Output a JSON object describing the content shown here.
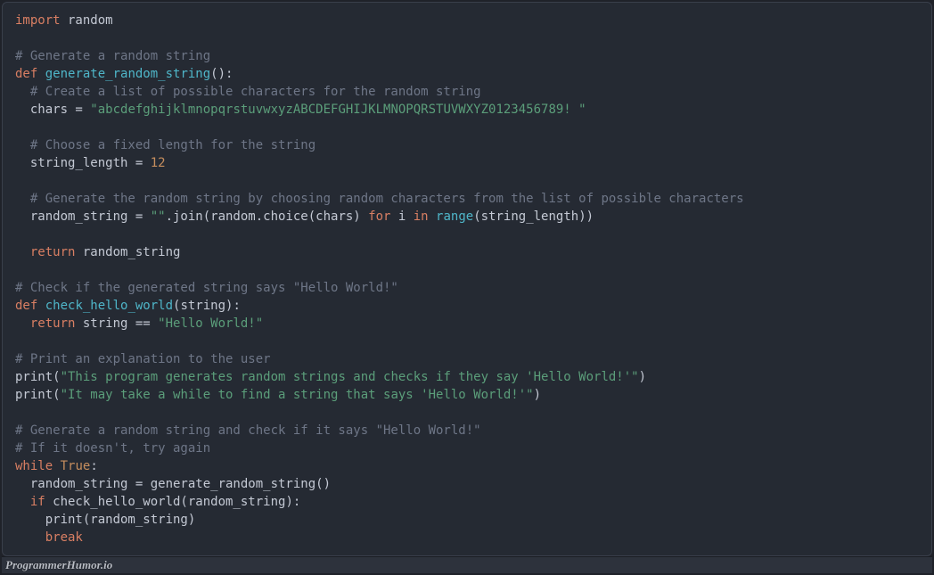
{
  "watermark": "ProgrammerHumor.io",
  "code": {
    "l1_import": "import",
    "l1_random": " random",
    "c1": "# Generate a random string",
    "l2_def": "def",
    "l2_sp": " ",
    "l2_fn": "generate_random_string",
    "l2_rest": "():",
    "c2": "  # Create a list of possible characters for the random string",
    "l3_pre": "  chars = ",
    "l3_str": "\"abcdefghijklmnopqrstuvwxyzABCDEFGHIJKLMNOPQRSTUVWXYZ0123456789! \"",
    "c3": "  # Choose a fixed length for the string",
    "l4_pre": "  string_length = ",
    "l4_num": "12",
    "c4": "  # Generate the random string by choosing random characters from the list of possible characters",
    "l5_pre": "  random_string = ",
    "l5_emptystr": "\"\"",
    "l5_mid": ".join(random.choice(chars) ",
    "l5_for": "for",
    "l5_i": " i ",
    "l5_in": "in",
    "l5_sp": " ",
    "l5_range": "range",
    "l5_end": "(string_length))",
    "l6_indent": "  ",
    "l6_return": "return",
    "l6_rest": " random_string",
    "c5": "# Check if the generated string says \"Hello World!\"",
    "l7_def": "def",
    "l7_sp": " ",
    "l7_fn": "check_hello_world",
    "l7_rest": "(string):",
    "l8_indent": "  ",
    "l8_return": "return",
    "l8_mid": " string == ",
    "l8_str": "\"Hello World!\"",
    "c6": "# Print an explanation to the user",
    "l9_pre": "print(",
    "l9_str": "\"This program generates random strings and checks if they say 'Hello World!'\"",
    "l9_end": ")",
    "l10_pre": "print(",
    "l10_str": "\"It may take a while to find a string that says 'Hello World!'\"",
    "l10_end": ")",
    "c7": "# Generate a random string and check if it says \"Hello World!\"",
    "c8": "# If it doesn't, try again",
    "l11_while": "while",
    "l11_sp": " ",
    "l11_true": "True",
    "l11_colon": ":",
    "l12": "  random_string = generate_random_string()",
    "l13_indent": "  ",
    "l13_if": "if",
    "l13_rest": " check_hello_world(random_string):",
    "l14": "    print(random_string)",
    "l15_indent": "    ",
    "l15_break": "break"
  }
}
